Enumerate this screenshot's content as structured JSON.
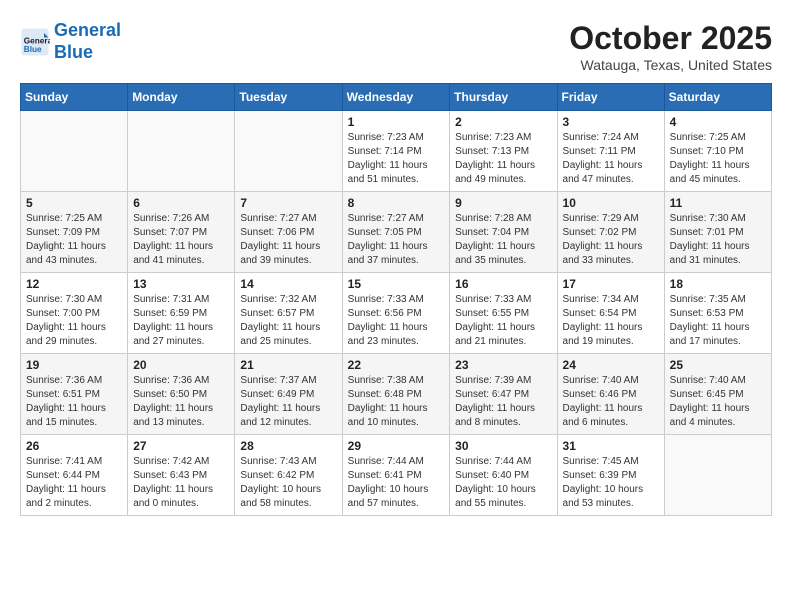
{
  "header": {
    "logo_line1": "General",
    "logo_line2": "Blue",
    "month": "October 2025",
    "location": "Watauga, Texas, United States"
  },
  "weekdays": [
    "Sunday",
    "Monday",
    "Tuesday",
    "Wednesday",
    "Thursday",
    "Friday",
    "Saturday"
  ],
  "weeks": [
    [
      {
        "day": "",
        "info": ""
      },
      {
        "day": "",
        "info": ""
      },
      {
        "day": "",
        "info": ""
      },
      {
        "day": "1",
        "info": "Sunrise: 7:23 AM\nSunset: 7:14 PM\nDaylight: 11 hours\nand 51 minutes."
      },
      {
        "day": "2",
        "info": "Sunrise: 7:23 AM\nSunset: 7:13 PM\nDaylight: 11 hours\nand 49 minutes."
      },
      {
        "day": "3",
        "info": "Sunrise: 7:24 AM\nSunset: 7:11 PM\nDaylight: 11 hours\nand 47 minutes."
      },
      {
        "day": "4",
        "info": "Sunrise: 7:25 AM\nSunset: 7:10 PM\nDaylight: 11 hours\nand 45 minutes."
      }
    ],
    [
      {
        "day": "5",
        "info": "Sunrise: 7:25 AM\nSunset: 7:09 PM\nDaylight: 11 hours\nand 43 minutes."
      },
      {
        "day": "6",
        "info": "Sunrise: 7:26 AM\nSunset: 7:07 PM\nDaylight: 11 hours\nand 41 minutes."
      },
      {
        "day": "7",
        "info": "Sunrise: 7:27 AM\nSunset: 7:06 PM\nDaylight: 11 hours\nand 39 minutes."
      },
      {
        "day": "8",
        "info": "Sunrise: 7:27 AM\nSunset: 7:05 PM\nDaylight: 11 hours\nand 37 minutes."
      },
      {
        "day": "9",
        "info": "Sunrise: 7:28 AM\nSunset: 7:04 PM\nDaylight: 11 hours\nand 35 minutes."
      },
      {
        "day": "10",
        "info": "Sunrise: 7:29 AM\nSunset: 7:02 PM\nDaylight: 11 hours\nand 33 minutes."
      },
      {
        "day": "11",
        "info": "Sunrise: 7:30 AM\nSunset: 7:01 PM\nDaylight: 11 hours\nand 31 minutes."
      }
    ],
    [
      {
        "day": "12",
        "info": "Sunrise: 7:30 AM\nSunset: 7:00 PM\nDaylight: 11 hours\nand 29 minutes."
      },
      {
        "day": "13",
        "info": "Sunrise: 7:31 AM\nSunset: 6:59 PM\nDaylight: 11 hours\nand 27 minutes."
      },
      {
        "day": "14",
        "info": "Sunrise: 7:32 AM\nSunset: 6:57 PM\nDaylight: 11 hours\nand 25 minutes."
      },
      {
        "day": "15",
        "info": "Sunrise: 7:33 AM\nSunset: 6:56 PM\nDaylight: 11 hours\nand 23 minutes."
      },
      {
        "day": "16",
        "info": "Sunrise: 7:33 AM\nSunset: 6:55 PM\nDaylight: 11 hours\nand 21 minutes."
      },
      {
        "day": "17",
        "info": "Sunrise: 7:34 AM\nSunset: 6:54 PM\nDaylight: 11 hours\nand 19 minutes."
      },
      {
        "day": "18",
        "info": "Sunrise: 7:35 AM\nSunset: 6:53 PM\nDaylight: 11 hours\nand 17 minutes."
      }
    ],
    [
      {
        "day": "19",
        "info": "Sunrise: 7:36 AM\nSunset: 6:51 PM\nDaylight: 11 hours\nand 15 minutes."
      },
      {
        "day": "20",
        "info": "Sunrise: 7:36 AM\nSunset: 6:50 PM\nDaylight: 11 hours\nand 13 minutes."
      },
      {
        "day": "21",
        "info": "Sunrise: 7:37 AM\nSunset: 6:49 PM\nDaylight: 11 hours\nand 12 minutes."
      },
      {
        "day": "22",
        "info": "Sunrise: 7:38 AM\nSunset: 6:48 PM\nDaylight: 11 hours\nand 10 minutes."
      },
      {
        "day": "23",
        "info": "Sunrise: 7:39 AM\nSunset: 6:47 PM\nDaylight: 11 hours\nand 8 minutes."
      },
      {
        "day": "24",
        "info": "Sunrise: 7:40 AM\nSunset: 6:46 PM\nDaylight: 11 hours\nand 6 minutes."
      },
      {
        "day": "25",
        "info": "Sunrise: 7:40 AM\nSunset: 6:45 PM\nDaylight: 11 hours\nand 4 minutes."
      }
    ],
    [
      {
        "day": "26",
        "info": "Sunrise: 7:41 AM\nSunset: 6:44 PM\nDaylight: 11 hours\nand 2 minutes."
      },
      {
        "day": "27",
        "info": "Sunrise: 7:42 AM\nSunset: 6:43 PM\nDaylight: 11 hours\nand 0 minutes."
      },
      {
        "day": "28",
        "info": "Sunrise: 7:43 AM\nSunset: 6:42 PM\nDaylight: 10 hours\nand 58 minutes."
      },
      {
        "day": "29",
        "info": "Sunrise: 7:44 AM\nSunset: 6:41 PM\nDaylight: 10 hours\nand 57 minutes."
      },
      {
        "day": "30",
        "info": "Sunrise: 7:44 AM\nSunset: 6:40 PM\nDaylight: 10 hours\nand 55 minutes."
      },
      {
        "day": "31",
        "info": "Sunrise: 7:45 AM\nSunset: 6:39 PM\nDaylight: 10 hours\nand 53 minutes."
      },
      {
        "day": "",
        "info": ""
      }
    ]
  ]
}
